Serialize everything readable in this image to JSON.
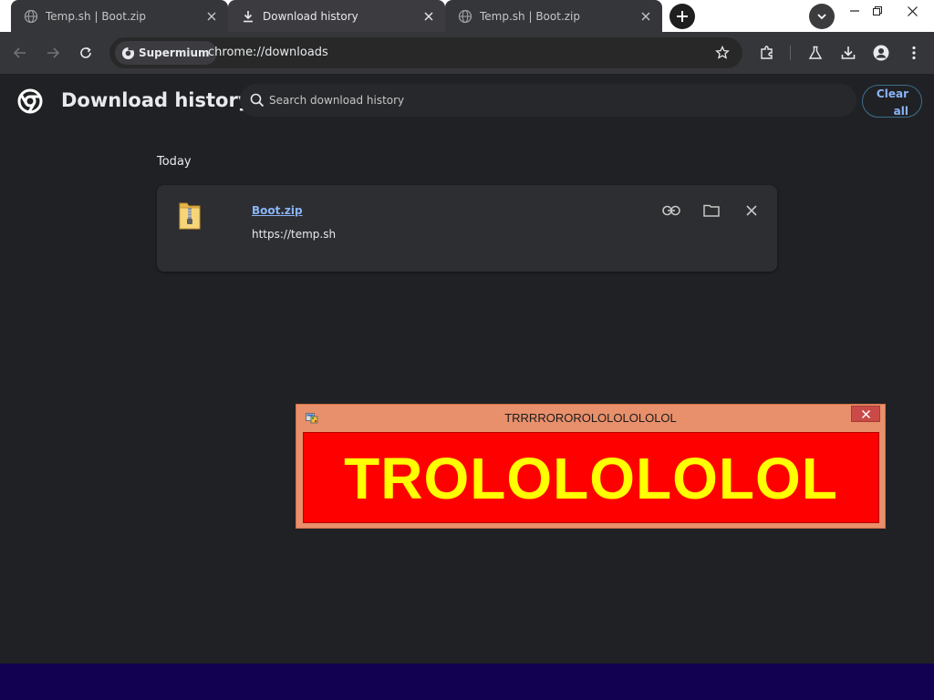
{
  "browser": {
    "tabs": [
      {
        "title": "Temp.sh | Boot.zip",
        "icon": "globe-icon",
        "active": false
      },
      {
        "title": "Download history",
        "icon": "download-icon",
        "active": true
      },
      {
        "title": "Temp.sh | Boot.zip",
        "icon": "globe-icon",
        "active": false
      }
    ],
    "site_chip": "Supermium",
    "url": "chrome://downloads"
  },
  "header": {
    "title": "Download history",
    "search_placeholder": "Search download history",
    "clear_all_line1": "Clear",
    "clear_all_line2": "all"
  },
  "downloads": {
    "date_heading": "Today",
    "items": [
      {
        "file_name": "Boot.zip",
        "url": "https://temp.sh",
        "icon": "zip-folder-icon"
      }
    ]
  },
  "popup": {
    "title": "TRRRROROROLOLOLOLOLOL",
    "message": "TROLOLOLOLOL",
    "colors": {
      "frame": "#e8906b",
      "body": "#ff0000",
      "text": "#ffff00"
    }
  },
  "colors": {
    "accent": "#8ab4f8",
    "background": "#202124",
    "bottom_strip": "#120050"
  }
}
